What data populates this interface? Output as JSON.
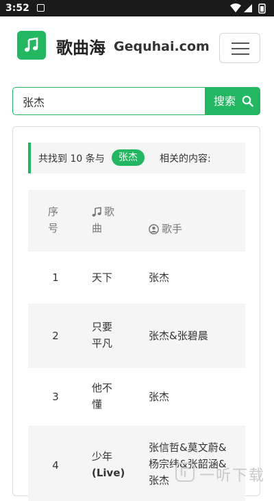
{
  "status_bar": {
    "time": "3:52"
  },
  "header": {
    "site_name_cn": "歌曲海",
    "site_name_en": "Gequhai.com"
  },
  "search": {
    "value": "张杰",
    "placeholder": "",
    "button_label": "搜索"
  },
  "results": {
    "notice_prefix": "共找到 10 条与",
    "keyword": "张杰",
    "notice_suffix": "相关的内容:",
    "headers": {
      "index_line1": "序",
      "index_line2": "号",
      "song_line1": "歌",
      "song_line2": "曲",
      "artist": "歌手"
    },
    "rows": [
      {
        "index": "1",
        "song_line1": "天下",
        "song_line2": "",
        "artist_line1": "张杰",
        "artist_line2": "",
        "artist_line3": ""
      },
      {
        "index": "2",
        "song_line1": "只要",
        "song_line2": "平凡",
        "artist_line1": "张杰&张碧晨",
        "artist_line2": "",
        "artist_line3": ""
      },
      {
        "index": "3",
        "song_line1": "他不",
        "song_line2": "懂",
        "artist_line1": "张杰",
        "artist_line2": "",
        "artist_line3": ""
      },
      {
        "index": "4",
        "song_line1": "少年",
        "song_line2": "(Live)",
        "artist_line1": "张信哲&莫文蔚&",
        "artist_line2": "杨宗纬&张韶涵&",
        "artist_line3": "张杰"
      }
    ]
  },
  "watermark": {
    "text": "一听下载"
  },
  "colors": {
    "accent": "#22b861",
    "statusbar": "#1a1a1a"
  },
  "icons": {
    "logo": "music-note-icon",
    "menu": "hamburger-icon",
    "search": "search-icon",
    "song_header": "music-note-icon",
    "artist_header": "user-circle-icon"
  }
}
